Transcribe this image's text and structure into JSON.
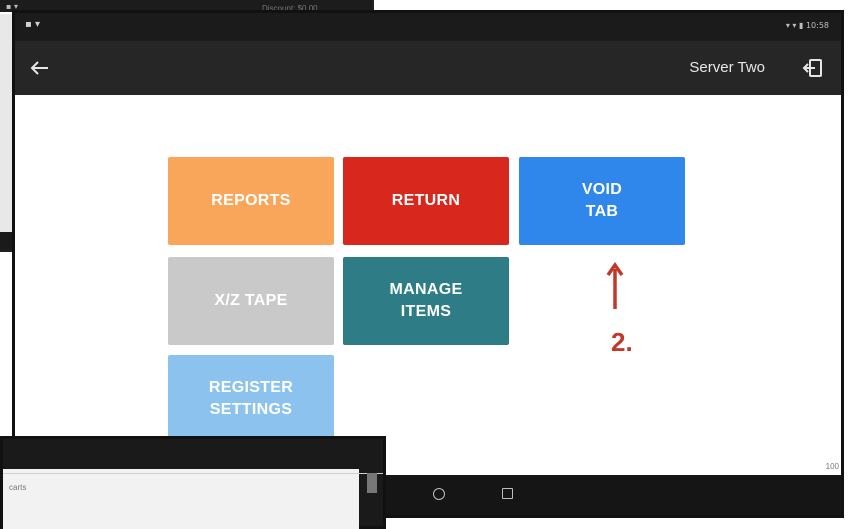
{
  "background_screenshot": {
    "faint_text": "Discount: $0.00"
  },
  "device": {
    "status_left": "▪ ▾",
    "status_right": "▾ ▾ ▮ 10:58",
    "app_bar": {
      "back_icon": "arrow-left-icon",
      "user_name": "Server Two",
      "logout_icon": "logout-icon"
    },
    "tiles": [
      {
        "label": "REPORTS",
        "color": "#f9a65a"
      },
      {
        "label": "RETURN",
        "color": "#d8271c"
      },
      {
        "label": "VOID\nTAB",
        "color": "#2f86eb"
      },
      {
        "label": "X/Z TAPE",
        "color": "#c9c9c9"
      },
      {
        "label": "MANAGE\nITEMS",
        "color": "#2e7d86"
      },
      {
        "label": "REGISTER\nSETTINGS",
        "color": "#8cc3ee"
      }
    ],
    "annotation": {
      "label": "2.",
      "color": "#c0392b"
    },
    "edge_number": "100"
  },
  "overlay_screenshot": {
    "text": "carts"
  }
}
